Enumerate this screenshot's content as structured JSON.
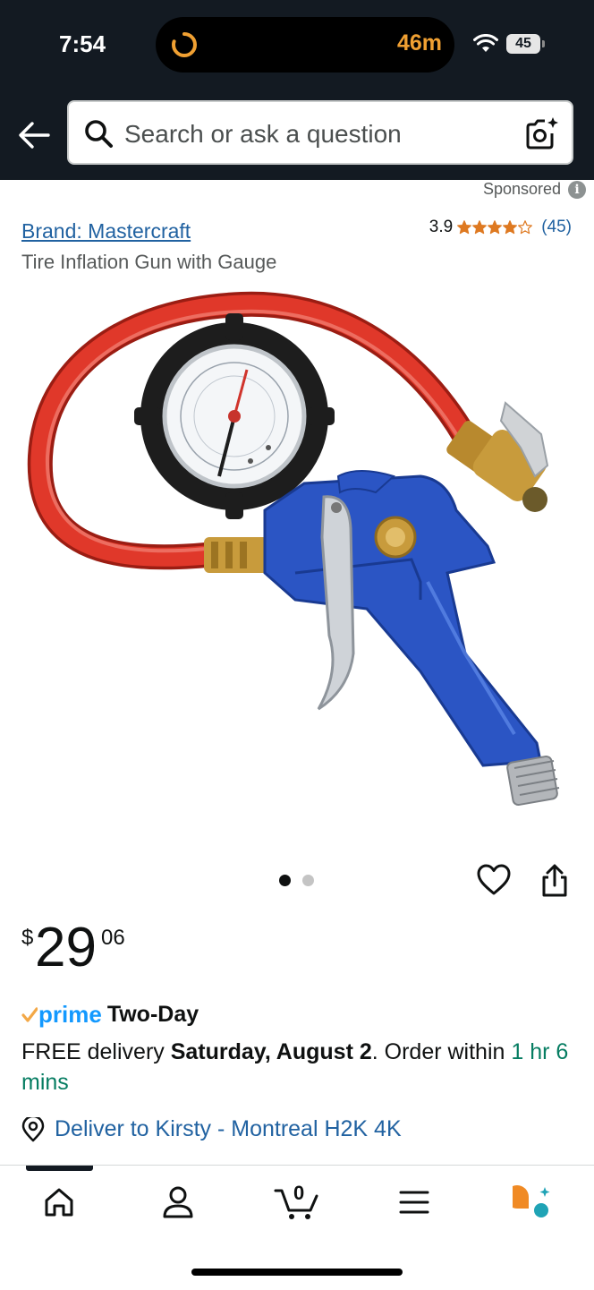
{
  "status_bar": {
    "time": "7:54",
    "activity_timer": "46m",
    "battery": "45"
  },
  "search": {
    "placeholder": "Search or ask a question"
  },
  "ad": {
    "sponsored_label": "Sponsored",
    "info_glyph": "i"
  },
  "product": {
    "brand": "Brand: Mastercraft",
    "title": "Tire Inflation Gun with Gauge",
    "rating_value": "3.9",
    "rating_stars_fraction": 0.78,
    "rating_count": "(45)",
    "image_alt_icon": "tire-inflator-image",
    "carousel": {
      "total": 2,
      "active": 1
    }
  },
  "price": {
    "currency": "$",
    "whole": "29",
    "fraction": "06"
  },
  "delivery": {
    "prime_word": "prime",
    "prime_speed": "Two-Day",
    "line_prefix": "FREE delivery ",
    "date": "Saturday, August 2",
    "line_middle": ". Order within ",
    "countdown": "1 hr 6 mins",
    "deliver_to": "Deliver to Kirsty - Montreal H2K 4K"
  },
  "nav": {
    "cart_count": "0",
    "items": [
      "home-icon",
      "account-icon",
      "cart-icon",
      "menu-icon",
      "rufus-icon"
    ]
  },
  "colors": {
    "header_bg": "#131a22",
    "link": "#2162a1",
    "star": "#de7921",
    "prime": "#1399ff",
    "countdown": "#067d62"
  }
}
